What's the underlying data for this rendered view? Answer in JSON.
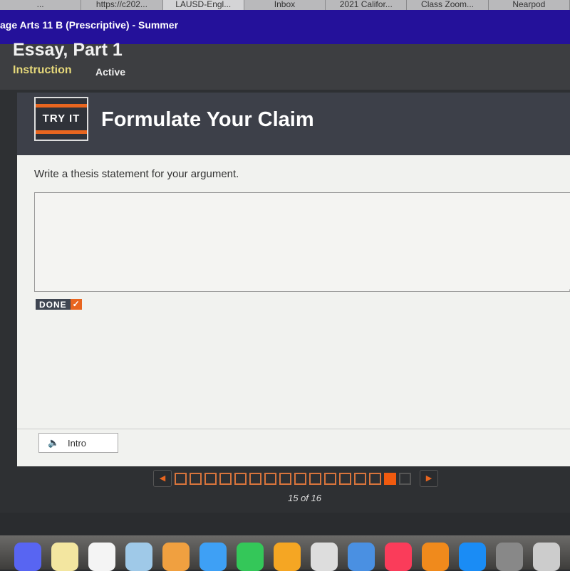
{
  "browser_tabs": [
    "...",
    "https://c202...",
    "LAUSD-Engl...",
    "Inbox",
    "2021 Califor...",
    "Class Zoom...",
    "Nearpod"
  ],
  "course_title": "age Arts 11 B (Prescriptive) - Summer",
  "page_title": "Essay, Part 1",
  "header_tabs": {
    "instruction": "Instruction",
    "active": "Active"
  },
  "banner": {
    "badge": "TRY IT",
    "title": "Formulate Your Claim"
  },
  "prompt": "Write a thesis statement for your argument.",
  "answer": {
    "value": "",
    "placeholder": ""
  },
  "done": {
    "label": "DONE",
    "check": "✓"
  },
  "intro_label": "Intro",
  "pager": {
    "current": 15,
    "total": 16,
    "label": "15 of 16"
  },
  "colors": {
    "accent": "#e8651f",
    "course_bar": "#24119a",
    "instruction_tab": "#e6d87a"
  },
  "dock_icons": [
    "discord",
    "notes",
    "reminders",
    "preview",
    "photos",
    "messages",
    "facetime",
    "pages",
    "numbers",
    "keynote",
    "music",
    "books",
    "app-store",
    "system-preferences",
    "printer"
  ]
}
